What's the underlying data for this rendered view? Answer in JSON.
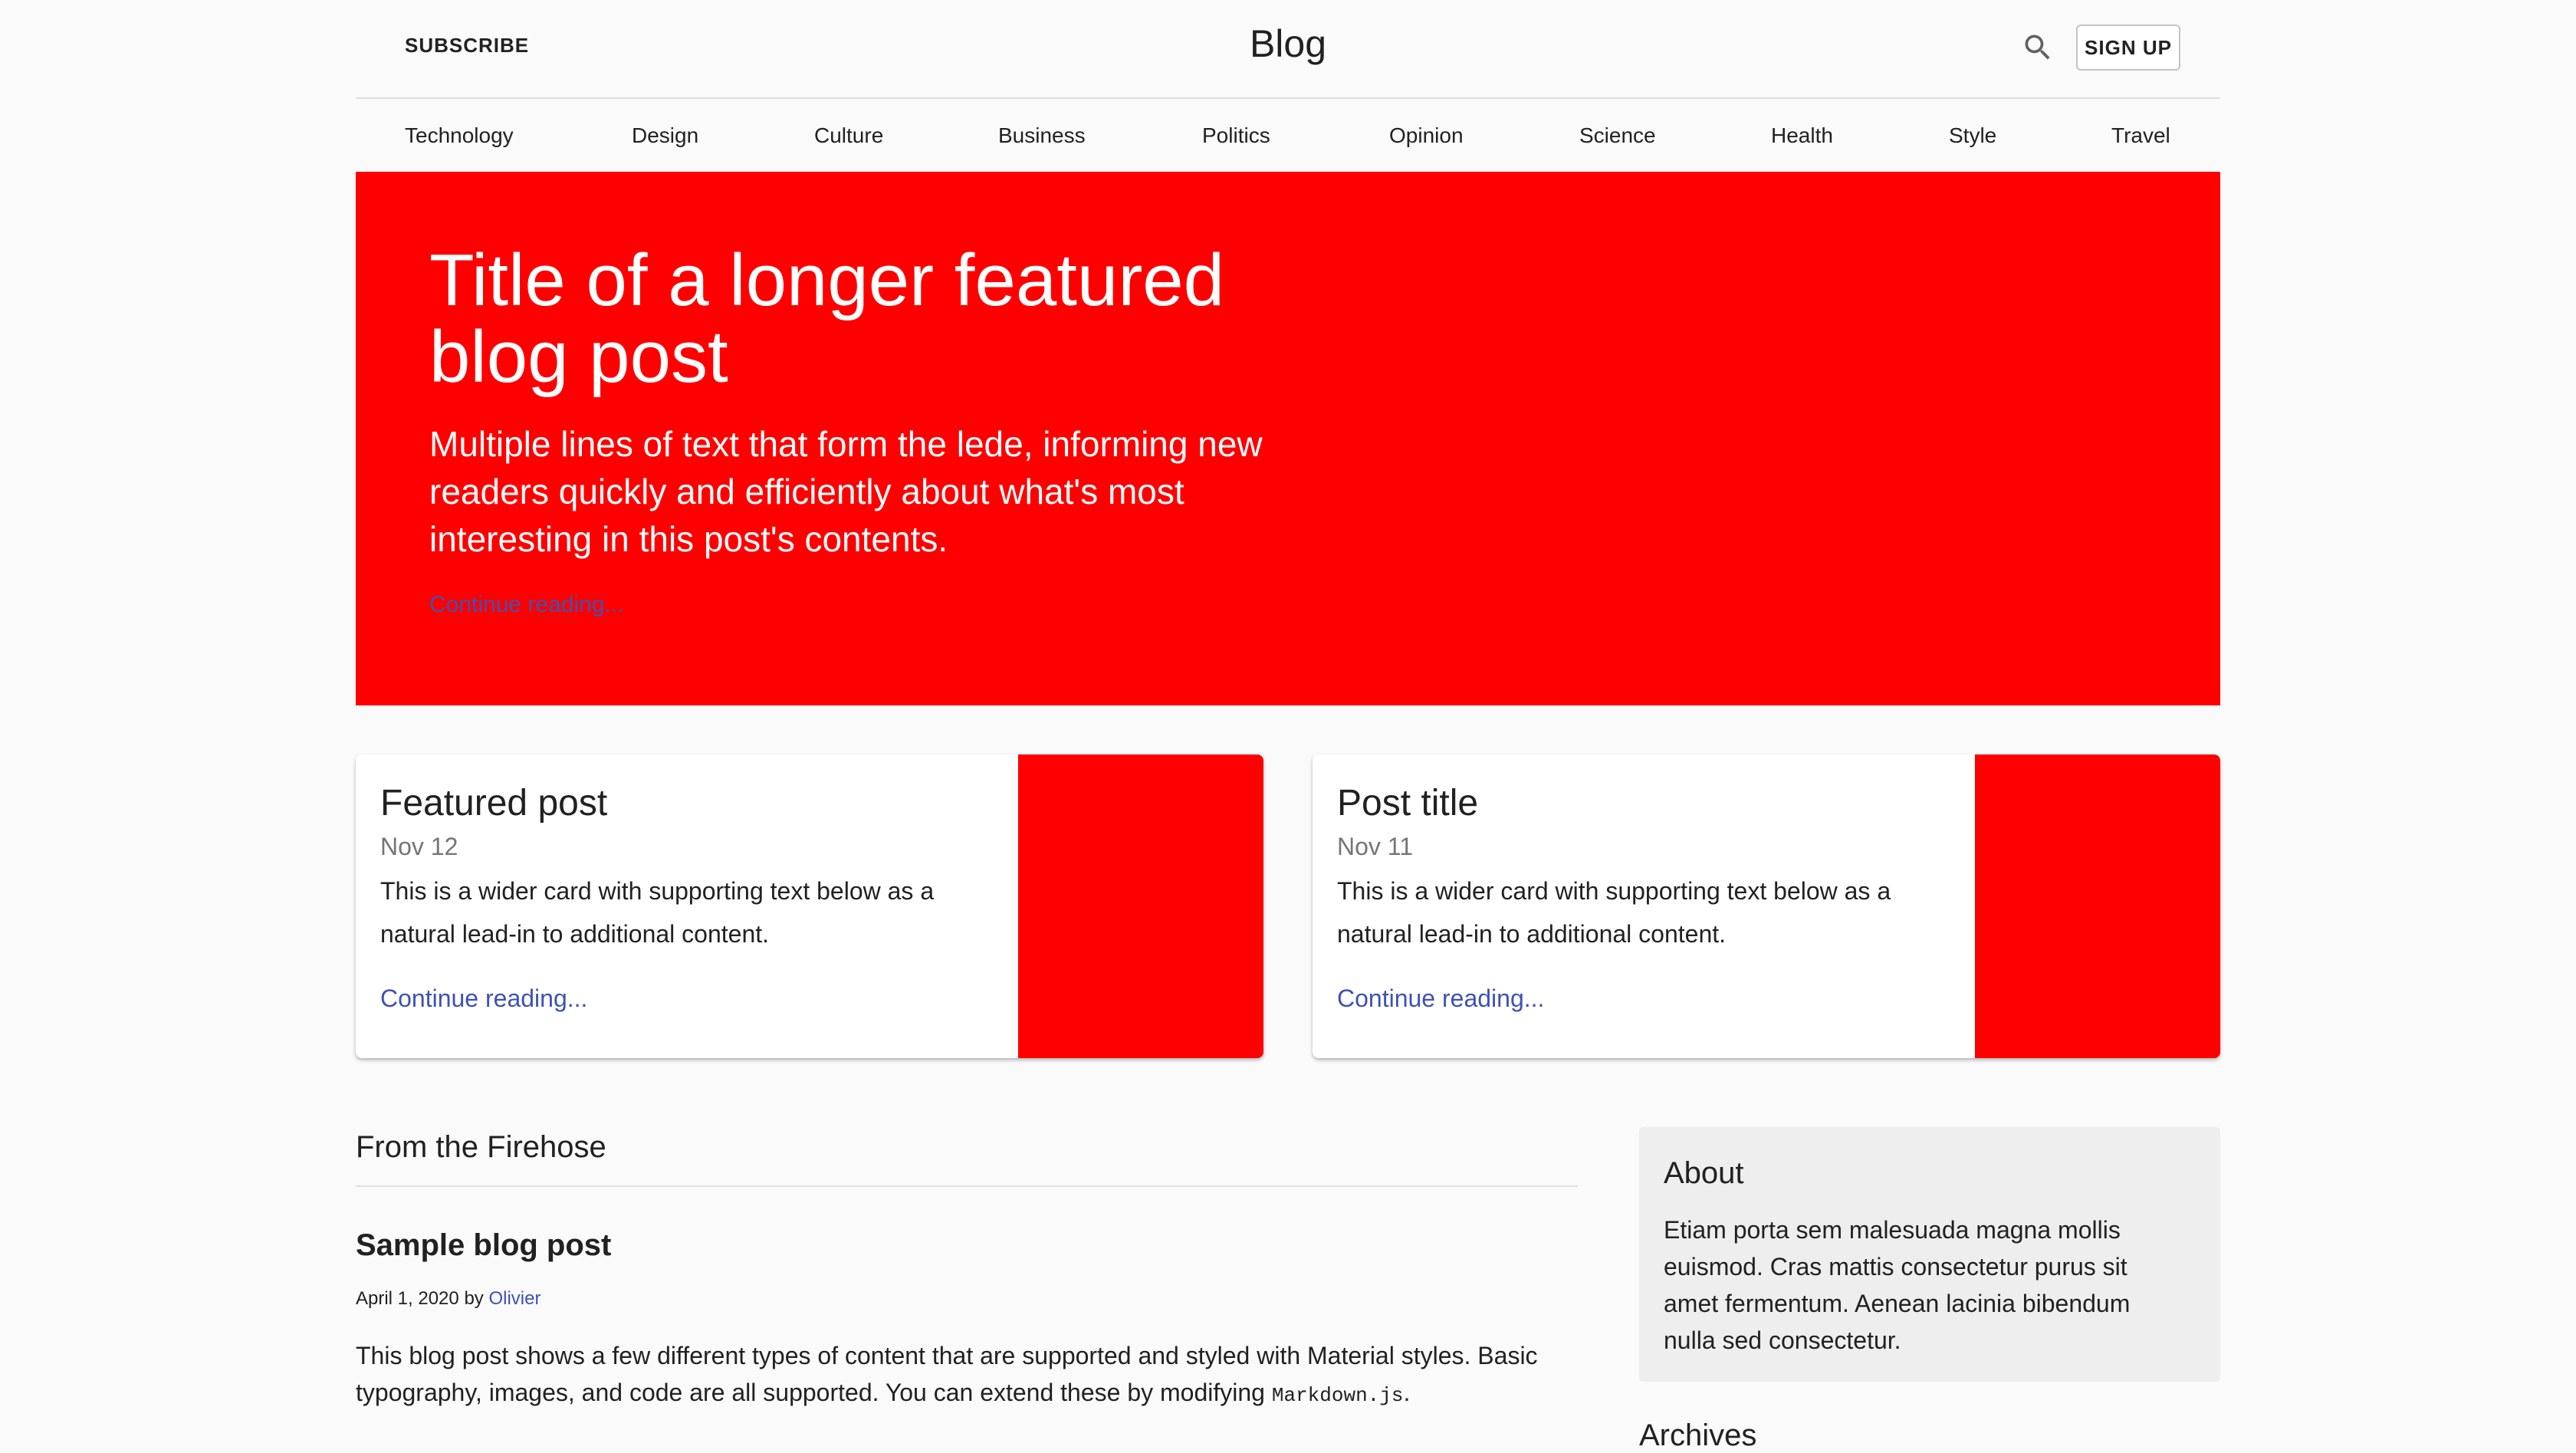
{
  "header": {
    "subscribe_label": "SUBSCRIBE",
    "title": "Blog",
    "signup_label": "SIGN UP"
  },
  "nav": {
    "items": [
      "Technology",
      "Design",
      "Culture",
      "Business",
      "Politics",
      "Opinion",
      "Science",
      "Health",
      "Style",
      "Travel"
    ]
  },
  "hero": {
    "title": "Title of a longer featured blog post",
    "lede": "Multiple lines of text that form the lede, informing new readers quickly and efficiently about what's most interesting in this post's contents.",
    "link": "Continue reading..."
  },
  "cards": [
    {
      "title": "Featured post",
      "date": "Nov 12",
      "text": "This is a wider card with supporting text below as a natural lead-in to additional content.",
      "link": "Continue reading..."
    },
    {
      "title": "Post title",
      "date": "Nov 11",
      "text": "This is a wider card with supporting text below as a natural lead-in to additional content.",
      "link": "Continue reading..."
    }
  ],
  "main": {
    "section_title": "From the Firehose",
    "post": {
      "title": "Sample blog post",
      "date": "April 1, 2020",
      "by": "by",
      "author": "Olivier",
      "body_start": "This blog post shows a few different types of content that are supported and styled with Material styles. Basic typography, images, and code are all supported. You can extend these by modifying ",
      "code": "Markdown.js",
      "body_end": "."
    }
  },
  "sidebar": {
    "about_title": "About",
    "about_text": "Etiam porta sem malesuada magna mollis euismod. Cras mattis consectetur purus sit amet fermentum. Aenean lacinia bibendum nulla sed consectetur.",
    "archives_title": "Archives"
  },
  "colors": {
    "hero_bg": "#ff0000",
    "link": "#3f51b5",
    "page_bg": "#fafafa"
  }
}
